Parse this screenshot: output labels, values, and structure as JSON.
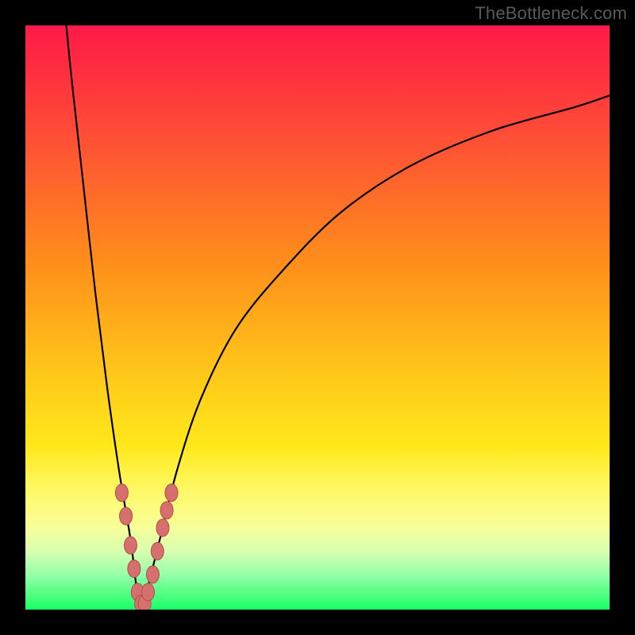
{
  "watermark": "TheBottleneck.com",
  "chart_data": {
    "type": "line",
    "title": "",
    "xlabel": "",
    "ylabel": "",
    "xlim": [
      0,
      100
    ],
    "ylim": [
      0,
      100
    ],
    "curve_black": {
      "name": "bottleneck-curve",
      "segments": [
        {
          "x": [
            7,
            8,
            10,
            12,
            14,
            16,
            18,
            19,
            20
          ],
          "y": [
            100,
            90,
            72,
            54,
            38,
            24,
            12,
            4,
            0
          ]
        },
        {
          "x": [
            20,
            21,
            23,
            26,
            30,
            36,
            44,
            54,
            66,
            80,
            94,
            100
          ],
          "y": [
            0,
            4,
            12,
            24,
            36,
            48,
            58,
            68,
            76,
            82,
            86,
            88
          ]
        }
      ]
    },
    "markers_red": {
      "name": "highlighted-points",
      "points": [
        {
          "x": 16.5,
          "y": 20
        },
        {
          "x": 17.2,
          "y": 16
        },
        {
          "x": 18.0,
          "y": 11
        },
        {
          "x": 18.6,
          "y": 7
        },
        {
          "x": 19.2,
          "y": 3
        },
        {
          "x": 19.8,
          "y": 1
        },
        {
          "x": 20.4,
          "y": 1
        },
        {
          "x": 21.0,
          "y": 3
        },
        {
          "x": 21.8,
          "y": 6
        },
        {
          "x": 22.6,
          "y": 10
        },
        {
          "x": 23.5,
          "y": 14
        },
        {
          "x": 24.2,
          "y": 17
        },
        {
          "x": 25.0,
          "y": 20
        }
      ]
    },
    "colors": {
      "curve": "#000000",
      "marker_fill": "#d6706f",
      "marker_stroke": "#b24b4a"
    }
  }
}
